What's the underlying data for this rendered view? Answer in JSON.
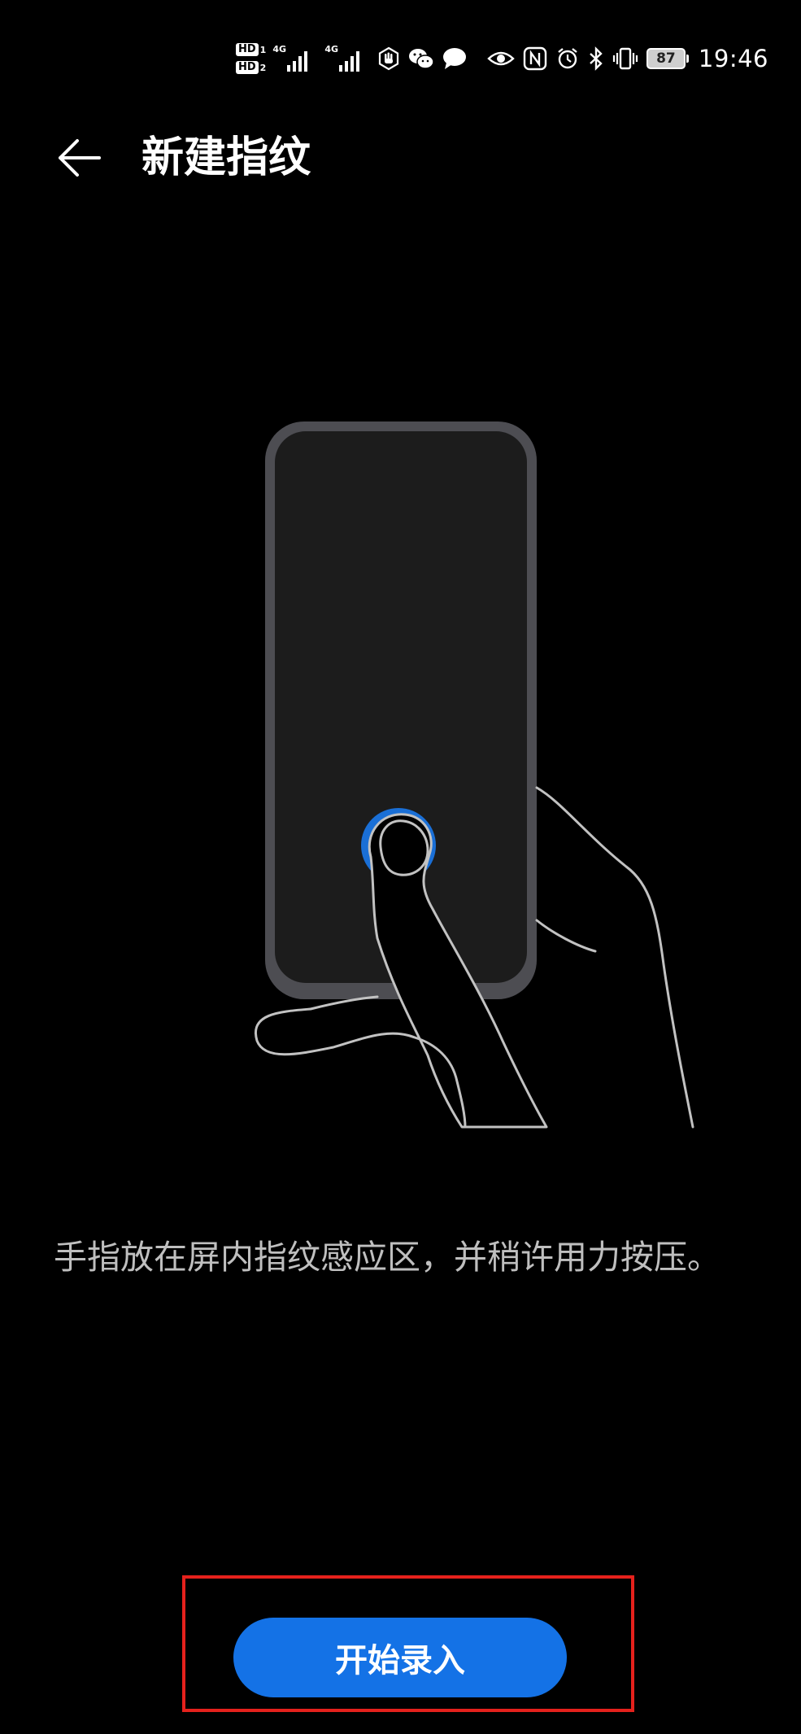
{
  "status_bar": {
    "sim1_badge": "HD",
    "sim1_index": "1",
    "sim2_badge": "HD",
    "sim2_index": "2",
    "sim1_network": "4G",
    "sim2_network": "4G",
    "battery_level": "87",
    "time": "19:46",
    "icons": [
      "hand-icon",
      "wechat-icon",
      "message-icon",
      "eye-icon",
      "nfc-icon",
      "alarm-icon",
      "bluetooth-icon",
      "vibrate-icon",
      "battery-icon"
    ]
  },
  "header": {
    "back_icon": "arrow-left-icon",
    "title": "新建指纹"
  },
  "illustration": {
    "subject": "hand-holding-phone-with-in-screen-fingerprint",
    "accent_color": "#1a6fd6"
  },
  "instruction": {
    "text": "手指放在屏内指纹感应区，并稍许用力按压。"
  },
  "action": {
    "start_label": "开始录入",
    "button_color": "#1472e6",
    "highlight_color": "#e5211c"
  }
}
